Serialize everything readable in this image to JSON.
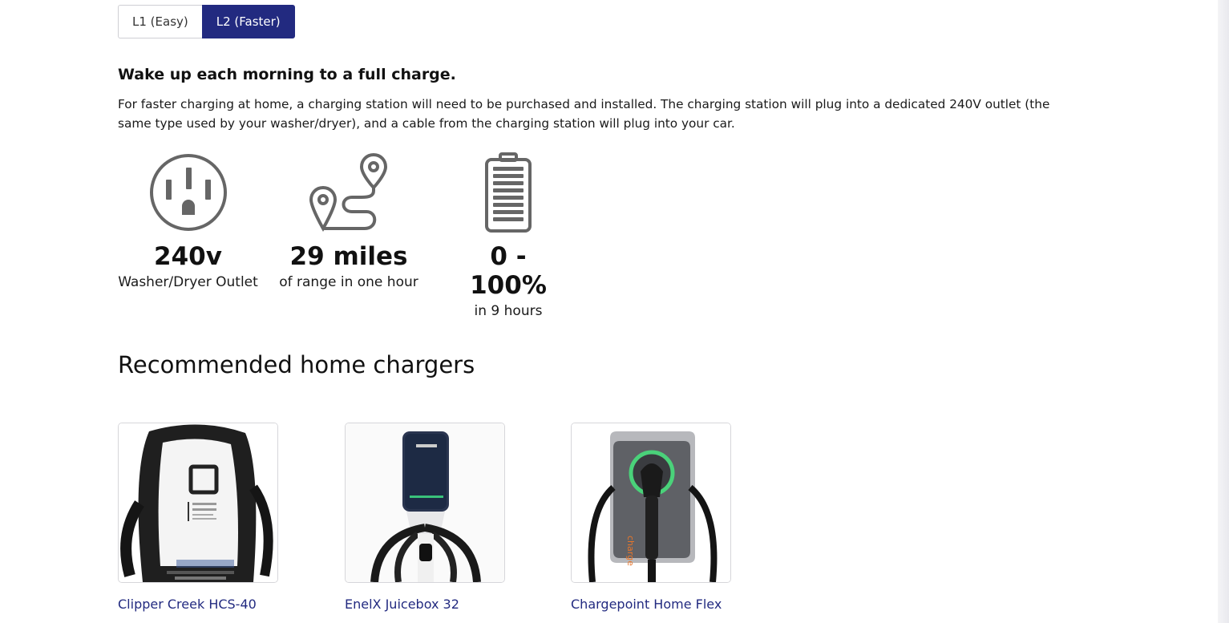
{
  "toggle": {
    "options": [
      {
        "label": "L1 (Easy)",
        "active": false
      },
      {
        "label": "L2 (Faster)",
        "active": true
      }
    ],
    "active_color": "#222a80"
  },
  "headline": "Wake up each morning to a full charge.",
  "description": "For faster charging at home, a charging station will need to be purchased and installed. The charging station will plug into a dedicated 240V outlet (the same type used by your washer/dryer), and a cable from the charging station will plug into your car.",
  "stats": [
    {
      "icon": "outlet-icon",
      "value": "240v",
      "caption": "Washer/Dryer Outlet"
    },
    {
      "icon": "route-map-pin-icon",
      "value": "29 miles",
      "caption": "of range in one hour"
    },
    {
      "icon": "battery-icon",
      "value": "0 - 100%",
      "caption": "in 9 hours"
    }
  ],
  "section_title": "Recommended home chargers",
  "chargers": [
    {
      "name": "Clipper Creek HCS-40",
      "image": "clipper-creek-charger-image"
    },
    {
      "name": "EnelX Juicebox 32",
      "image": "juicebox-charger-image"
    },
    {
      "name": "Chargepoint Home Flex",
      "image": "chargepoint-charger-image"
    }
  ],
  "link_color": "#222a80"
}
